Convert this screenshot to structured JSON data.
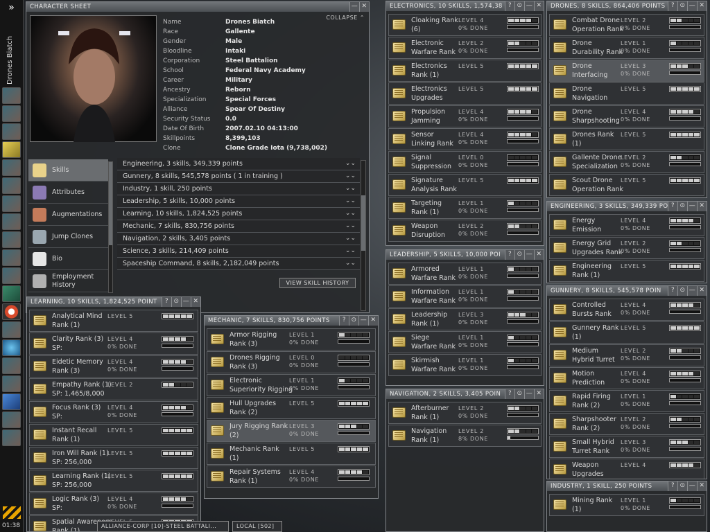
{
  "taskbar": {
    "vertical_label": "Drones Biatch",
    "clock": "01:38"
  },
  "character_sheet": {
    "title": "CHARACTER SHEET",
    "collapse": "COLLAPSE",
    "fields": [
      {
        "k": "Name",
        "v": "Drones Biatch"
      },
      {
        "k": "Race",
        "v": "Gallente"
      },
      {
        "k": "Gender",
        "v": "Male"
      },
      {
        "k": "Bloodline",
        "v": "Intaki"
      },
      {
        "k": "Corporation",
        "v": "Steel Battalion"
      },
      {
        "k": "School",
        "v": "Federal Navy Academy"
      },
      {
        "k": "Career",
        "v": "Military"
      },
      {
        "k": "Ancestry",
        "v": "Reborn"
      },
      {
        "k": "Specialization",
        "v": "Special Forces"
      },
      {
        "k": "Alliance",
        "v": "Spear Of Destiny"
      },
      {
        "k": "Security Status",
        "v": "0.0"
      },
      {
        "k": "Date Of Birth",
        "v": "2007.02.10 04:13:00"
      },
      {
        "k": "Skillpoints",
        "v": "8,399,103"
      },
      {
        "k": "Clone",
        "v": "Clone Grade Iota (9,738,002)"
      }
    ],
    "nav": [
      {
        "label": "Skills"
      },
      {
        "label": "Attributes"
      },
      {
        "label": "Augmentations"
      },
      {
        "label": "Jump Clones"
      },
      {
        "label": "Bio"
      },
      {
        "label": "Employment\nHistory"
      }
    ],
    "groups": [
      "Engineering, 3 skills, 349,339 points",
      "Gunnery, 8 skills, 545,578 points ( 1 in training )",
      "Industry, 1 skill, 250 points",
      "Leadership, 5 skills, 10,000 points",
      "Learning, 10 skills, 1,824,525 points",
      "Mechanic, 7 skills, 830,756 points",
      "Navigation, 2 skills, 3,405 points",
      "Science, 3 skills, 214,409 points",
      "Spaceship Command, 8 skills, 2,182,049 points"
    ],
    "history_button": "VIEW SKILL HISTORY"
  },
  "windows": {
    "learning": {
      "title": "LEARNING, 10 SKILLS, 1,824,525 POINT",
      "skills": [
        {
          "name": "Analytical Mind\nRank (1)",
          "level": "LEVEL 5",
          "done": "",
          "n": 5,
          "p": null
        },
        {
          "name": "Clarity Rank (3)\nSP:",
          "level": "LEVEL 4",
          "done": "0% DONE",
          "n": 4,
          "p": 0
        },
        {
          "name": "Eidetic Memory\nRank (3)",
          "level": "LEVEL 4",
          "done": "0% DONE",
          "n": 4,
          "p": 0
        },
        {
          "name": "Empathy Rank (1)\nSP: 1,465/8,000",
          "level": "LEVEL 2",
          "done": "",
          "n": 2,
          "p": null
        },
        {
          "name": "Focus Rank (3)\nSP:",
          "level": "LEVEL 4",
          "done": "0% DONE",
          "n": 4,
          "p": 0
        },
        {
          "name": "Instant Recall\nRank (1)",
          "level": "LEVEL 5",
          "done": "",
          "n": 5,
          "p": null
        },
        {
          "name": "Iron Will Rank (1)\nSP: 256,000",
          "level": "LEVEL 5",
          "done": "",
          "n": 5,
          "p": null
        },
        {
          "name": "Learning Rank (1)\nSP: 256,000",
          "level": "LEVEL 5",
          "done": "",
          "n": 5,
          "p": null
        },
        {
          "name": "Logic Rank (3)\nSP:",
          "level": "LEVEL 4",
          "done": "0% DONE",
          "n": 4,
          "p": 0
        },
        {
          "name": "Spatial Awareness\nRank (1)",
          "level": "LEVEL 5",
          "done": "",
          "n": 5,
          "p": null
        }
      ]
    },
    "mechanic": {
      "title": "MECHANIC, 7 SKILLS, 830,756 POINTS",
      "skills": [
        {
          "name": "Armor Rigging\nRank (3)",
          "level": "LEVEL 1",
          "done": "0% DONE",
          "n": 1,
          "p": 0
        },
        {
          "name": "Drones Rigging\nRank (3)",
          "level": "LEVEL 0",
          "done": "0% DONE",
          "n": 0,
          "p": 0
        },
        {
          "name": "Electronic\nSuperiority Rigging",
          "level": "LEVEL 1",
          "done": "0% DONE",
          "n": 1,
          "p": 0
        },
        {
          "name": "Hull Upgrades\nRank (2)",
          "level": "LEVEL 5",
          "done": "",
          "n": 5,
          "p": null
        },
        {
          "name": "Jury Rigging Rank\n(2)",
          "level": "LEVEL 3",
          "done": "0% DONE",
          "n": 3,
          "p": 0,
          "hl": true
        },
        {
          "name": "Mechanic Rank\n(1)",
          "level": "LEVEL 5",
          "done": "",
          "n": 5,
          "p": null
        },
        {
          "name": "Repair Systems\nRank (1)",
          "level": "LEVEL 4",
          "done": "0% DONE",
          "n": 4,
          "p": 0
        }
      ]
    },
    "electronics": {
      "title": "ELECTRONICS, 10 SKILLS, 1,574,38",
      "skills": [
        {
          "name": "Cloaking Rank\n(6)",
          "level": "LEVEL 4",
          "done": "0% DONE",
          "n": 4,
          "p": 0
        },
        {
          "name": "Electronic\nWarfare Rank",
          "level": "LEVEL 2",
          "done": "0% DONE",
          "n": 2,
          "p": 0
        },
        {
          "name": "Electronics\nRank (1)",
          "level": "LEVEL 5",
          "done": "",
          "n": 5,
          "p": null
        },
        {
          "name": "Electronics\nUpgrades",
          "level": "LEVEL 5",
          "done": "",
          "n": 5,
          "p": null
        },
        {
          "name": "Propulsion\nJamming",
          "level": "LEVEL 4",
          "done": "0% DONE",
          "n": 4,
          "p": 0
        },
        {
          "name": "Sensor\nLinking Rank",
          "level": "LEVEL 4",
          "done": "0% DONE",
          "n": 4,
          "p": 0
        },
        {
          "name": "Signal\nSuppression",
          "level": "LEVEL 0",
          "done": "0% DONE",
          "n": 0,
          "p": 0
        },
        {
          "name": "Signature\nAnalysis Rank",
          "level": "LEVEL 5",
          "done": "",
          "n": 5,
          "p": null
        },
        {
          "name": "Targeting\nRank (1)",
          "level": "LEVEL 1",
          "done": "0% DONE",
          "n": 1,
          "p": 0
        },
        {
          "name": "Weapon\nDisruption",
          "level": "LEVEL 2",
          "done": "0% DONE",
          "n": 2,
          "p": 0
        }
      ]
    },
    "leadership": {
      "title": "LEADERSHIP, 5 SKILLS, 10,000 POI",
      "skills": [
        {
          "name": "Armored\nWarfare Rank",
          "level": "LEVEL 1",
          "done": "0% DONE",
          "n": 1,
          "p": 0
        },
        {
          "name": "Information\nWarfare Rank",
          "level": "LEVEL 1",
          "done": "0% DONE",
          "n": 1,
          "p": 0
        },
        {
          "name": "Leadership\nRank (1)",
          "level": "LEVEL 3",
          "done": "0% DONE",
          "n": 3,
          "p": 0
        },
        {
          "name": "Siege\nWarfare Rank",
          "level": "LEVEL 1",
          "done": "0% DONE",
          "n": 1,
          "p": 0
        },
        {
          "name": "Skirmish\nWarfare Rank",
          "level": "LEVEL 1",
          "done": "0% DONE",
          "n": 1,
          "p": 0
        }
      ]
    },
    "navigation": {
      "title": "NAVIGATION, 2 SKILLS, 3,405 POIN",
      "skills": [
        {
          "name": "Afterburner\nRank (1)",
          "level": "LEVEL 2",
          "done": "0% DONE",
          "n": 2,
          "p": 0
        },
        {
          "name": "Navigation\nRank (1)",
          "level": "LEVEL 2",
          "done": "8% DONE",
          "n": 2,
          "p": 8
        }
      ]
    },
    "drones": {
      "title": "DRONES, 8 SKILLS, 864,406 POINTS",
      "skills": [
        {
          "name": "Combat Drone\nOperation Rank",
          "level": "LEVEL 2",
          "done": "0% DONE",
          "n": 2,
          "p": 0
        },
        {
          "name": "Drone\nDurability Rank",
          "level": "LEVEL 1",
          "done": "0% DONE",
          "n": 1,
          "p": 0
        },
        {
          "name": "Drone\nInterfacing",
          "level": "LEVEL 3",
          "done": "0% DONE",
          "n": 3,
          "p": 0,
          "hl": true
        },
        {
          "name": "Drone\nNavigation",
          "level": "LEVEL 5",
          "done": "",
          "n": 5,
          "p": null
        },
        {
          "name": "Drone\nSharpshooting",
          "level": "LEVEL 4",
          "done": "0% DONE",
          "n": 4,
          "p": 0
        },
        {
          "name": "Drones Rank\n(1)",
          "level": "LEVEL 5",
          "done": "",
          "n": 5,
          "p": null
        },
        {
          "name": "Gallente Drone\nSpecialization",
          "level": "LEVEL 2",
          "done": "0% DONE",
          "n": 2,
          "p": 0
        },
        {
          "name": "Scout Drone\nOperation Rank",
          "level": "LEVEL 5",
          "done": "",
          "n": 5,
          "p": null
        }
      ]
    },
    "engineering": {
      "title": "ENGINEERING, 3 SKILLS, 349,339 PO",
      "skills": [
        {
          "name": "Energy\nEmission",
          "level": "LEVEL 4",
          "done": "0% DONE",
          "n": 4,
          "p": 0
        },
        {
          "name": "Energy Grid\nUpgrades Rank",
          "level": "LEVEL 2",
          "done": "0% DONE",
          "n": 2,
          "p": 0
        },
        {
          "name": "Engineering\nRank (1)",
          "level": "LEVEL 5",
          "done": "",
          "n": 5,
          "p": null
        }
      ]
    },
    "gunnery": {
      "title": "GUNNERY, 8 SKILLS, 545,578 POIN",
      "skills": [
        {
          "name": "Controlled\nBursts Rank",
          "level": "LEVEL 4",
          "done": "0% DONE",
          "n": 4,
          "p": 0
        },
        {
          "name": "Gunnery Rank\n(1)",
          "level": "LEVEL 5",
          "done": "",
          "n": 5,
          "p": null
        },
        {
          "name": "Medium\nHybrid Turret",
          "level": "LEVEL 2",
          "done": "0% DONE",
          "n": 2,
          "p": 0
        },
        {
          "name": "Motion\nPrediction",
          "level": "LEVEL 4",
          "done": "0% DONE",
          "n": 4,
          "p": 0
        },
        {
          "name": "Rapid Firing\nRank (2)",
          "level": "LEVEL 1",
          "done": "0% DONE",
          "n": 1,
          "p": 0
        },
        {
          "name": "Sharpshooter\nRank (2)",
          "level": "LEVEL 2",
          "done": "0% DONE",
          "n": 2,
          "p": 0
        },
        {
          "name": "Small Hybrid\nTurret Rank",
          "level": "LEVEL 3",
          "done": "0% DONE",
          "n": 3,
          "p": 0
        },
        {
          "name": "Weapon\nUpgrades",
          "level": "LEVEL 4",
          "done": "",
          "n": 4,
          "p": null
        }
      ]
    },
    "industry": {
      "title": "INDUSTRY, 1 SKILL, 250 POINTS",
      "skills": [
        {
          "name": "Mining Rank\n(1)",
          "level": "LEVEL 1",
          "done": "0% DONE",
          "n": 1,
          "p": 0
        }
      ]
    }
  },
  "window_buttons": {
    "help": "?",
    "pin": "⊙",
    "min": "—",
    "close": "✕"
  },
  "chat_tabs": [
    "ALLIANCE-CORP [10]-STEEL BATTALI...",
    "LOCAL [502]"
  ]
}
